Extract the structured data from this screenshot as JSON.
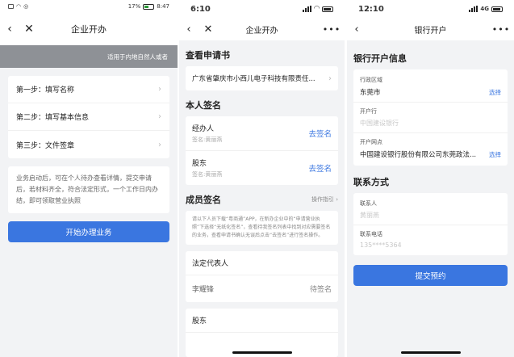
{
  "screen1": {
    "status": {
      "battery": "17%",
      "time": "8:47"
    },
    "nav": {
      "title": "企业开办"
    },
    "banner": "适用于内地自然人或者",
    "steps": [
      {
        "label": "第一步：填写名称"
      },
      {
        "label": "第二步：填写基本信息"
      },
      {
        "label": "第三步：文件签章"
      }
    ],
    "description": "业务启动后，可在个人待办查看详情，提交申请后，若材料齐全，符合法定形式，一个工作日内办结，即可领取营业执照",
    "start_button": "开始办理业务"
  },
  "screen2": {
    "status": {
      "time": "6:10"
    },
    "nav": {
      "title": "企业开办"
    },
    "view_application": {
      "title": "查看申请书",
      "company": "广东省肇庆市小西儿电子科技有限责任..."
    },
    "self_sign": {
      "title": "本人签名",
      "rows": [
        {
          "role": "经办人",
          "signer": "签名:黄丽燕",
          "action": "去签名"
        },
        {
          "role": "股东",
          "signer": "签名:黄丽燕",
          "action": "去签名"
        }
      ]
    },
    "member_sign": {
      "title": "成员签名",
      "guide": "操作指引",
      "note": "请以下人员下载“粤商通”APP，在新办企业中的“申请营业执照”下选择“无纸化签名”，查看待我签名列表中找到对应需要签名的业务，查看申请书确认无误后点击“去签名”进行签名操作。",
      "members": [
        {
          "title": "法定代表人",
          "name": "李耀锋",
          "status": "待签名"
        },
        {
          "title": "股东"
        }
      ]
    }
  },
  "screen3": {
    "status": {
      "time": "12:10",
      "network": "4G"
    },
    "nav": {
      "title": "银行开户"
    },
    "bank_info": {
      "title": "银行开户信息",
      "fields": [
        {
          "label": "行政区域",
          "value": "东莞市",
          "action": "选择"
        },
        {
          "label": "开户行",
          "placeholder": "中国建设银行"
        },
        {
          "label": "开户网点",
          "value": "中国建设银行股份有限公司东莞政法...",
          "action": "选择"
        }
      ]
    },
    "contact": {
      "title": "联系方式",
      "fields": [
        {
          "label": "联系人",
          "placeholder": "黄丽燕"
        },
        {
          "label": "联系电话",
          "placeholder": "135****5364"
        }
      ]
    },
    "submit_button": "提交预约"
  }
}
